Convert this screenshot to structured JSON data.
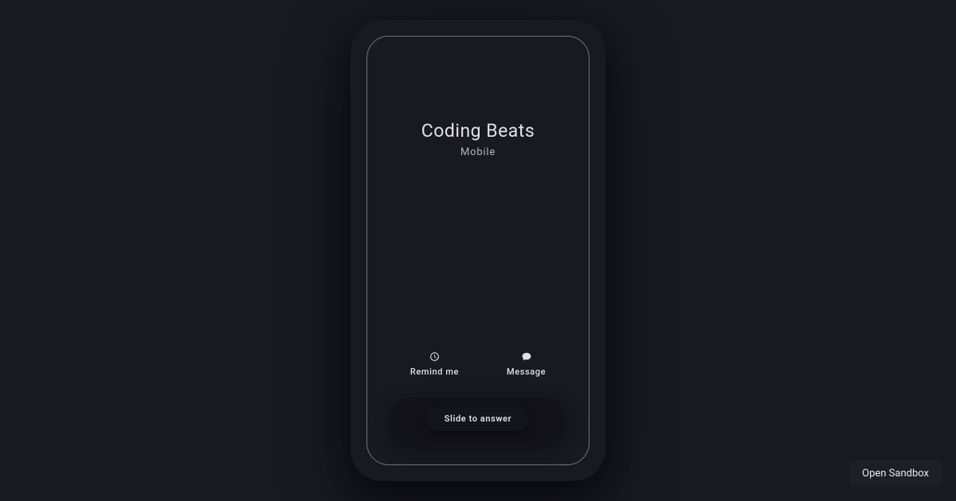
{
  "caller": {
    "name": "Coding Beats",
    "subtitle": "Mobile"
  },
  "actions": {
    "remind": {
      "label": "Remind me"
    },
    "message": {
      "label": "Message"
    }
  },
  "slider": {
    "label": "Slide to answer"
  },
  "sandbox": {
    "label": "Open Sandbox"
  }
}
